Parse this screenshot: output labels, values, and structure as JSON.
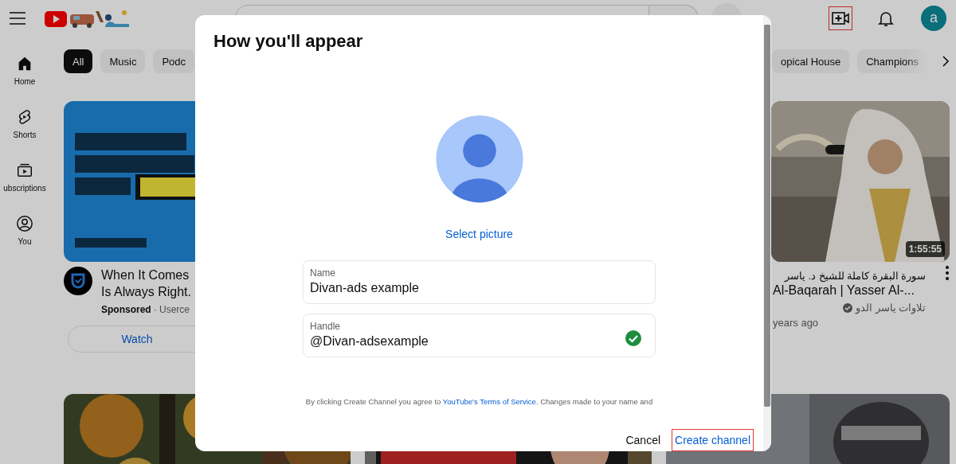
{
  "topbar": {
    "create_highlighted": true,
    "avatar_letter": "a"
  },
  "sidebar": {
    "items": [
      {
        "kind": "home",
        "label": "Home"
      },
      {
        "kind": "shorts",
        "label": "Shorts"
      },
      {
        "kind": "subscriptions",
        "label": "ubscriptions"
      },
      {
        "kind": "you",
        "label": "You"
      }
    ]
  },
  "chips": [
    {
      "label": "All",
      "selected": true
    },
    {
      "label": "Music",
      "selected": false
    },
    {
      "label": "Podc",
      "selected": false
    },
    {
      "label": "opical House",
      "selected": false
    },
    {
      "label": "Champions",
      "selected": false
    }
  ],
  "videos": [
    {
      "kind": "ad",
      "title_lines": [
        "When It Comes",
        "Is Always Right."
      ],
      "sponsored": "Sponsored",
      "channel": "· Userce",
      "action": "Watch"
    },
    {
      "kind": "video",
      "title_lines": [
        "سورة البقرة كاملة للشيخ د. ياسر",
        "Al-Baqarah | Yasser Al-..."
      ],
      "channel": "تلاوات ياسر الدو",
      "verified": true,
      "age": "years ago",
      "duration": "1:55:55"
    }
  ],
  "dialog": {
    "title": "How you'll appear",
    "select_picture": "Select picture",
    "fields": [
      {
        "label": "Name",
        "value": "Divan-ads example",
        "valid": false
      },
      {
        "label": "Handle",
        "value": "@Divan-adsexample",
        "valid": true
      }
    ],
    "disclaimer": {
      "before": "By clicking Create Channel you agree to ",
      "link": "YouTube's Terms of Service",
      "after": ". Changes made to your name and"
    },
    "buttons": [
      {
        "label": "Cancel",
        "highlighted": false
      },
      {
        "label": "Create channel",
        "highlighted": true
      }
    ]
  }
}
